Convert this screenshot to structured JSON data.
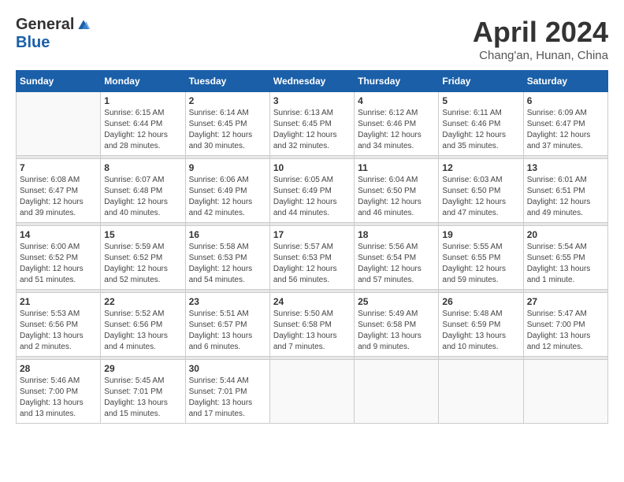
{
  "logo": {
    "general": "General",
    "blue": "Blue"
  },
  "title": "April 2024",
  "location": "Chang'an, Hunan, China",
  "weekdays": [
    "Sunday",
    "Monday",
    "Tuesday",
    "Wednesday",
    "Thursday",
    "Friday",
    "Saturday"
  ],
  "weeks": [
    [
      {
        "day": "",
        "info": ""
      },
      {
        "day": "1",
        "info": "Sunrise: 6:15 AM\nSunset: 6:44 PM\nDaylight: 12 hours\nand 28 minutes."
      },
      {
        "day": "2",
        "info": "Sunrise: 6:14 AM\nSunset: 6:45 PM\nDaylight: 12 hours\nand 30 minutes."
      },
      {
        "day": "3",
        "info": "Sunrise: 6:13 AM\nSunset: 6:45 PM\nDaylight: 12 hours\nand 32 minutes."
      },
      {
        "day": "4",
        "info": "Sunrise: 6:12 AM\nSunset: 6:46 PM\nDaylight: 12 hours\nand 34 minutes."
      },
      {
        "day": "5",
        "info": "Sunrise: 6:11 AM\nSunset: 6:46 PM\nDaylight: 12 hours\nand 35 minutes."
      },
      {
        "day": "6",
        "info": "Sunrise: 6:09 AM\nSunset: 6:47 PM\nDaylight: 12 hours\nand 37 minutes."
      }
    ],
    [
      {
        "day": "7",
        "info": "Sunrise: 6:08 AM\nSunset: 6:47 PM\nDaylight: 12 hours\nand 39 minutes."
      },
      {
        "day": "8",
        "info": "Sunrise: 6:07 AM\nSunset: 6:48 PM\nDaylight: 12 hours\nand 40 minutes."
      },
      {
        "day": "9",
        "info": "Sunrise: 6:06 AM\nSunset: 6:49 PM\nDaylight: 12 hours\nand 42 minutes."
      },
      {
        "day": "10",
        "info": "Sunrise: 6:05 AM\nSunset: 6:49 PM\nDaylight: 12 hours\nand 44 minutes."
      },
      {
        "day": "11",
        "info": "Sunrise: 6:04 AM\nSunset: 6:50 PM\nDaylight: 12 hours\nand 46 minutes."
      },
      {
        "day": "12",
        "info": "Sunrise: 6:03 AM\nSunset: 6:50 PM\nDaylight: 12 hours\nand 47 minutes."
      },
      {
        "day": "13",
        "info": "Sunrise: 6:01 AM\nSunset: 6:51 PM\nDaylight: 12 hours\nand 49 minutes."
      }
    ],
    [
      {
        "day": "14",
        "info": "Sunrise: 6:00 AM\nSunset: 6:52 PM\nDaylight: 12 hours\nand 51 minutes."
      },
      {
        "day": "15",
        "info": "Sunrise: 5:59 AM\nSunset: 6:52 PM\nDaylight: 12 hours\nand 52 minutes."
      },
      {
        "day": "16",
        "info": "Sunrise: 5:58 AM\nSunset: 6:53 PM\nDaylight: 12 hours\nand 54 minutes."
      },
      {
        "day": "17",
        "info": "Sunrise: 5:57 AM\nSunset: 6:53 PM\nDaylight: 12 hours\nand 56 minutes."
      },
      {
        "day": "18",
        "info": "Sunrise: 5:56 AM\nSunset: 6:54 PM\nDaylight: 12 hours\nand 57 minutes."
      },
      {
        "day": "19",
        "info": "Sunrise: 5:55 AM\nSunset: 6:55 PM\nDaylight: 12 hours\nand 59 minutes."
      },
      {
        "day": "20",
        "info": "Sunrise: 5:54 AM\nSunset: 6:55 PM\nDaylight: 13 hours\nand 1 minute."
      }
    ],
    [
      {
        "day": "21",
        "info": "Sunrise: 5:53 AM\nSunset: 6:56 PM\nDaylight: 13 hours\nand 2 minutes."
      },
      {
        "day": "22",
        "info": "Sunrise: 5:52 AM\nSunset: 6:56 PM\nDaylight: 13 hours\nand 4 minutes."
      },
      {
        "day": "23",
        "info": "Sunrise: 5:51 AM\nSunset: 6:57 PM\nDaylight: 13 hours\nand 6 minutes."
      },
      {
        "day": "24",
        "info": "Sunrise: 5:50 AM\nSunset: 6:58 PM\nDaylight: 13 hours\nand 7 minutes."
      },
      {
        "day": "25",
        "info": "Sunrise: 5:49 AM\nSunset: 6:58 PM\nDaylight: 13 hours\nand 9 minutes."
      },
      {
        "day": "26",
        "info": "Sunrise: 5:48 AM\nSunset: 6:59 PM\nDaylight: 13 hours\nand 10 minutes."
      },
      {
        "day": "27",
        "info": "Sunrise: 5:47 AM\nSunset: 7:00 PM\nDaylight: 13 hours\nand 12 minutes."
      }
    ],
    [
      {
        "day": "28",
        "info": "Sunrise: 5:46 AM\nSunset: 7:00 PM\nDaylight: 13 hours\nand 13 minutes."
      },
      {
        "day": "29",
        "info": "Sunrise: 5:45 AM\nSunset: 7:01 PM\nDaylight: 13 hours\nand 15 minutes."
      },
      {
        "day": "30",
        "info": "Sunrise: 5:44 AM\nSunset: 7:01 PM\nDaylight: 13 hours\nand 17 minutes."
      },
      {
        "day": "",
        "info": ""
      },
      {
        "day": "",
        "info": ""
      },
      {
        "day": "",
        "info": ""
      },
      {
        "day": "",
        "info": ""
      }
    ]
  ]
}
